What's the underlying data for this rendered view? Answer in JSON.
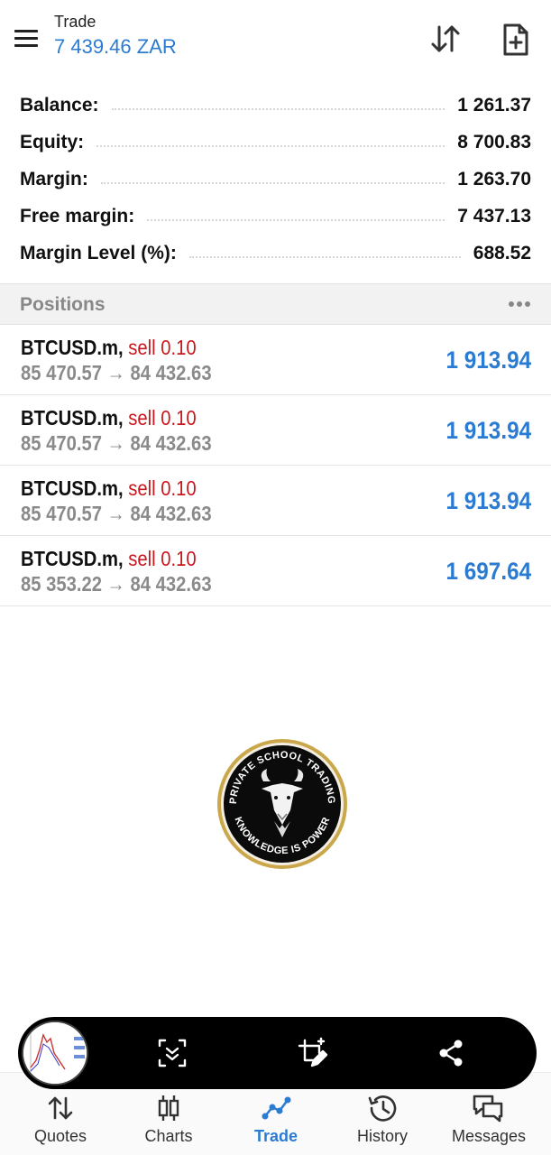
{
  "header": {
    "title": "Trade",
    "subtitle": "7 439.46 ZAR",
    "icons": [
      "menu-icon",
      "sort-icon",
      "new-order-icon"
    ]
  },
  "summary": [
    {
      "label": "Balance:",
      "value": "1 261.37"
    },
    {
      "label": "Equity:",
      "value": "8 700.83"
    },
    {
      "label": "Margin:",
      "value": "1 263.70"
    },
    {
      "label": "Free margin:",
      "value": "7 437.13"
    },
    {
      "label": "Margin Level (%):",
      "value": "688.52"
    }
  ],
  "positions_section": {
    "title": "Positions"
  },
  "positions": [
    {
      "symbol": "BTCUSD.m,",
      "side": "sell 0.10",
      "prices": "85 470.57 → 84 432.63",
      "profit": "1 913.94"
    },
    {
      "symbol": "BTCUSD.m,",
      "side": "sell 0.10",
      "prices": "85 470.57 → 84 432.63",
      "profit": "1 913.94"
    },
    {
      "symbol": "BTCUSD.m,",
      "side": "sell 0.10",
      "prices": "85 470.57 → 84 432.63",
      "profit": "1 913.94"
    },
    {
      "symbol": "BTCUSD.m,",
      "side": "sell 0.10",
      "prices": "85 353.22 → 84 432.63",
      "profit": "1 697.64"
    }
  ],
  "watermark": {
    "top_text": "PRIVATE SCHOOL TRADING",
    "bottom_text": "KNOWLEDGE IS POWER"
  },
  "screenshot_toolbar": {
    "icons": [
      "screenshot-thumbnail",
      "scroll-capture-icon",
      "crop-edit-icon",
      "share-icon"
    ]
  },
  "bottom_nav": [
    {
      "label": "Quotes",
      "icon": "quotes-icon"
    },
    {
      "label": "Charts",
      "icon": "charts-icon"
    },
    {
      "label": "Trade",
      "icon": "trade-icon",
      "active": true
    },
    {
      "label": "History",
      "icon": "history-icon"
    },
    {
      "label": "Messages",
      "icon": "messages-icon"
    }
  ],
  "colors": {
    "accent": "#2b7bd2",
    "sell": "#c8181e",
    "muted": "#8a8a8a"
  }
}
